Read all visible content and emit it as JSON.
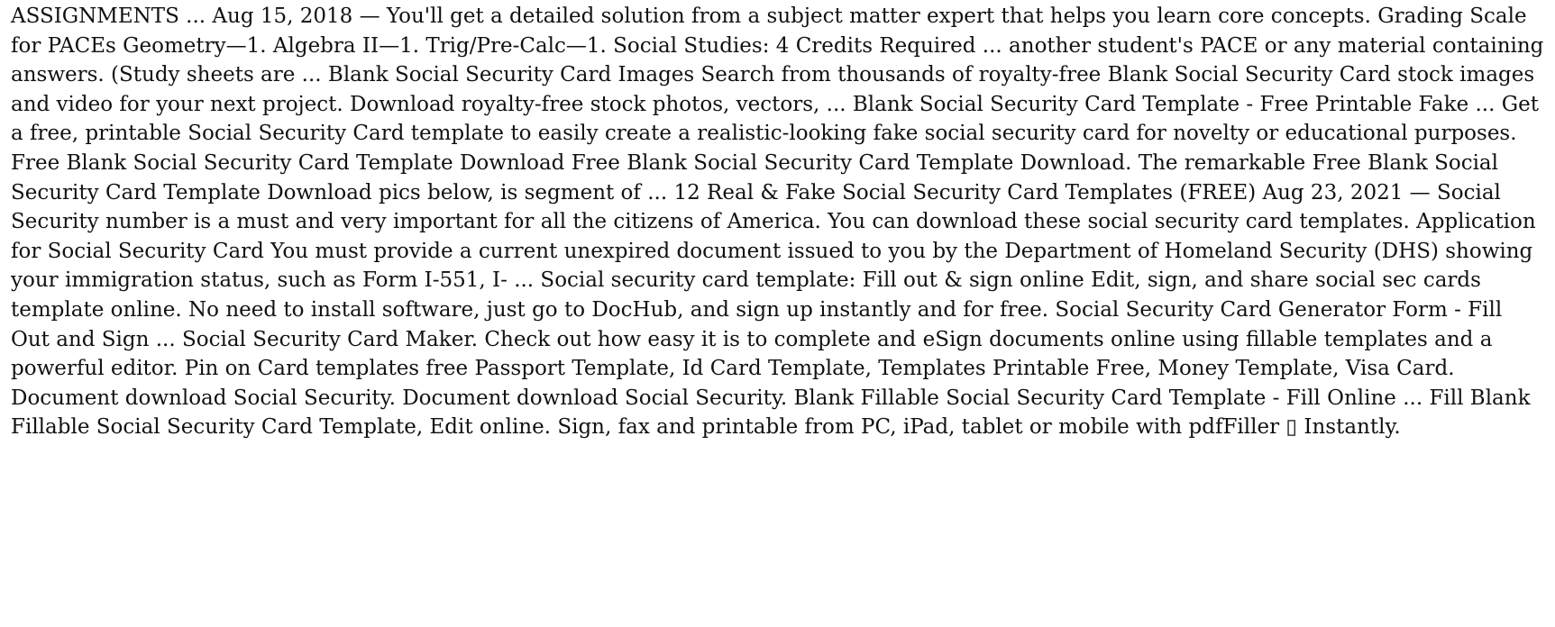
{
  "document": {
    "paragraph": "ASSIGNMENTS ... Aug 15, 2018 — You'll get a detailed solution from a subject matter expert that helps you learn core concepts. Grading Scale for PACEs Geometry—1. Algebra II—1. Trig/Pre-Calc—1. Social Studies: 4 Credits Required ... another student's PACE or any material containing answers. (Study sheets are ... Blank Social Security Card Images Search from thousands of royalty-free Blank Social Security Card stock images and video for your next project. Download royalty-free stock photos, vectors, ... Blank Social Security Card Template - Free Printable Fake ... Get a free, printable Social Security Card template to easily create a realistic-looking fake social security card for novelty or educational purposes. Free Blank Social Security Card Template Download Free Blank Social Security Card Template Download. The remarkable Free Blank Social Security Card Template Download pics below, is segment of ... 12 Real & Fake Social Security Card Templates (FREE) Aug 23, 2021 — Social Security number is a must and very important for all the citizens of America. You can download these social security card templates. Application for Social Security Card You must provide a current unexpired document issued to you by the Department of Homeland Security (DHS) showing your immigration status, such as Form I-551, I- ... Social security card template: Fill out & sign online Edit, sign, and share social sec cards template online. No need to install software, just go to DocHub, and sign up instantly and for free. Social Security Card Generator Form - Fill Out and Sign ... Social Security Card Maker. Check out how easy it is to complete and eSign documents online using fillable templates and a powerful editor. Pin on Card templates free Passport Template, Id Card Template, Templates Printable Free, Money Template, Visa Card. Document download Social Security. Document download Social Security. Blank Fillable Social Security Card Template - Fill Online ... Fill Blank Fillable Social Security Card Template, Edit online. Sign, fax and printable from PC, iPad, tablet or mobile with pdfFiller ▯ Instantly."
  }
}
